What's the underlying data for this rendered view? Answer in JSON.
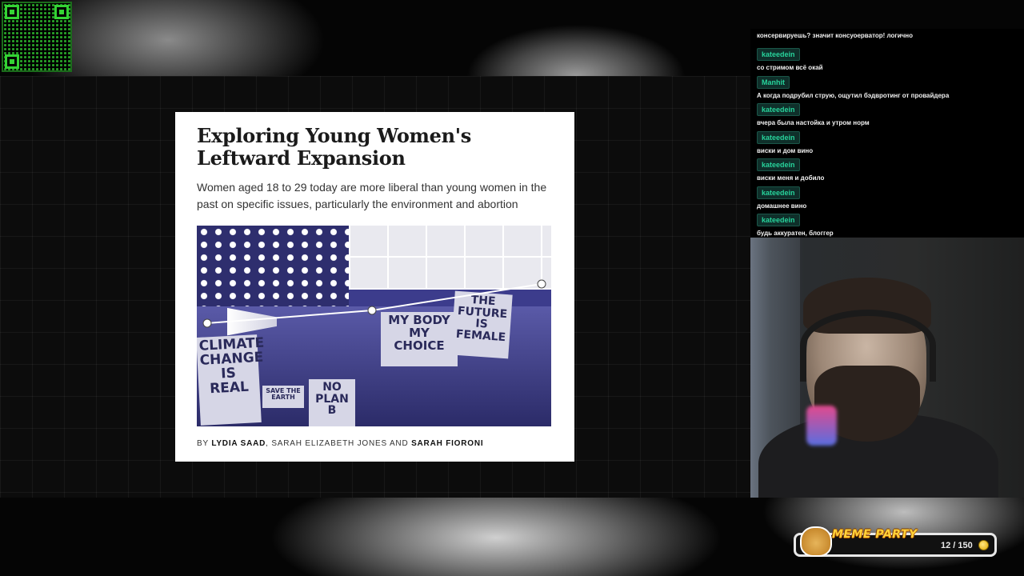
{
  "article": {
    "title": "Exploring Young Women's Leftward Expansion",
    "subtitle": "Women aged 18 to 29 today are more liberal than young women in the past on specific issues, particularly the environment and abortion",
    "byline_prefix": "BY ",
    "author1": "LYDIA SAAD",
    "sep1": ", SARAH ELIZABETH JONES AND ",
    "author3": "SARAH FIORONI",
    "photo_signs": {
      "climate": "CLIMATE CHANGE IS REAL",
      "my_body": "MY BODY MY CHOICE",
      "future": "THE FUTURE IS FEMALE",
      "no_plan": "NO PLAN B",
      "save_earth": "SAVE THE EARTH"
    }
  },
  "chat": {
    "top_line": "консервируешь? значит консуоерватор! логично",
    "messages": [
      {
        "user": "kateedein",
        "text": "со стримом всё окай"
      },
      {
        "user": "Manhit",
        "text": "А когда подрубил струю, ощутил бэдвротинг от провайдера"
      },
      {
        "user": "kateedein",
        "text": "вчера была настойка и утром норм"
      },
      {
        "user": "kateedein",
        "text": "виски и дом вино"
      },
      {
        "user": "kateedein",
        "text": "виски меня и добило"
      },
      {
        "user": "kateedein",
        "text": "домашнее вино"
      },
      {
        "user": "kateedein",
        "text": "будь аккуратен, блоггер"
      }
    ]
  },
  "meme_party": {
    "label": "MEME PARTY",
    "count": "12 / 150"
  },
  "colors": {
    "chat_name": "#27d39b",
    "meme_label": "#ffd23a",
    "qr": "#34d334"
  }
}
